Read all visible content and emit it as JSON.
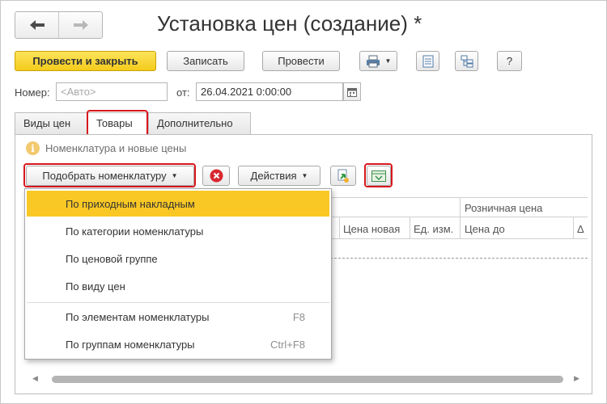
{
  "window": {
    "title": "Установка цен (создание) *"
  },
  "nav": {
    "back_label": "🡐",
    "forward_label": "🡒"
  },
  "toolbar": {
    "post_close_label": "Провести и закрыть",
    "save_label": "Записать",
    "post_label": "Провести",
    "help_label": "?"
  },
  "header": {
    "number_label": "Номер:",
    "number_placeholder": "<Авто>",
    "date_label": "от:",
    "date_value": "26.04.2021  0:00:00"
  },
  "tabs": [
    {
      "label": "Виды цен"
    },
    {
      "label": "Товары"
    },
    {
      "label": "Дополнительно"
    }
  ],
  "goods": {
    "hint": "Номенклатура и новые цены",
    "pick_label": "Подобрать номенклатуру",
    "actions_label": "Действия"
  },
  "grid": {
    "group_header": "Розничная цена",
    "columns": [
      "Цена новая",
      "Ед. изм.",
      "Цена до",
      "Δ"
    ]
  },
  "dropdown": {
    "items": [
      {
        "label": "По приходным накладным",
        "shortcut": ""
      },
      {
        "label": "По категории номенклатуры",
        "shortcut": ""
      },
      {
        "label": "По ценовой группе",
        "shortcut": ""
      },
      {
        "label": "По виду цен",
        "shortcut": ""
      },
      {
        "label": "По элементам номенклатуры",
        "shortcut": "F8"
      },
      {
        "label": "По группам номенклатуры",
        "shortcut": "Ctrl+F8"
      }
    ]
  },
  "colors": {
    "accent": "#f9c825",
    "highlight_border": "#d9161d"
  }
}
